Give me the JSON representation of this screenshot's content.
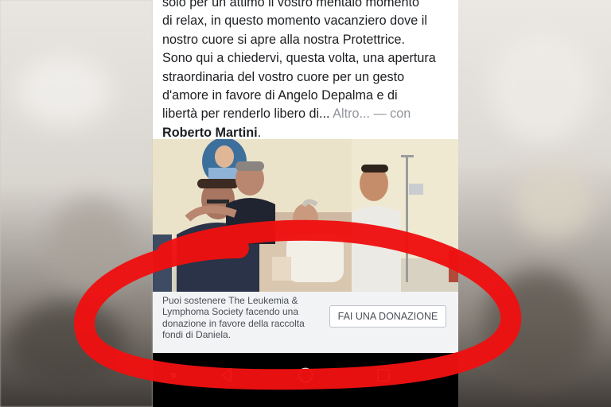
{
  "post": {
    "lines": [
      "solo per un attimo il vostro mentalo momento",
      "di relax, in questo momento vacanziero dove il",
      "nostro cuore si apre alla nostra Protettrice.",
      "Sono qui a chiedervi, questa volta, una apertura",
      "straordinaria del vostro cuore per un gesto",
      "d'amore in favore di Angelo Depalma e di",
      "libertà per renderlo libero di..."
    ],
    "more_label": "Altro...",
    "with_label": "— con",
    "tagged_name": "Roberto Martini",
    "tagged_suffix": "."
  },
  "photo": {
    "description_icon": "photo-of-people-around-hospital-bed"
  },
  "donation": {
    "text": "Puoi sostenere The Leukemia & Lymphoma Society facendo una donazione in favore della raccolta fondi di Daniela.",
    "button_label": "FAI UNA DONAZIONE"
  },
  "navbar": {
    "items": [
      {
        "icon": "menu-dot-icon"
      },
      {
        "icon": "back-triangle-icon"
      },
      {
        "icon": "home-circle-icon"
      },
      {
        "icon": "recents-square-icon"
      }
    ]
  },
  "colors": {
    "annotation": "#ee1111",
    "text": "#1c1e21",
    "muted": "#90949c",
    "donate_bg": "#f2f3f5",
    "navbar_bg": "#000000"
  }
}
